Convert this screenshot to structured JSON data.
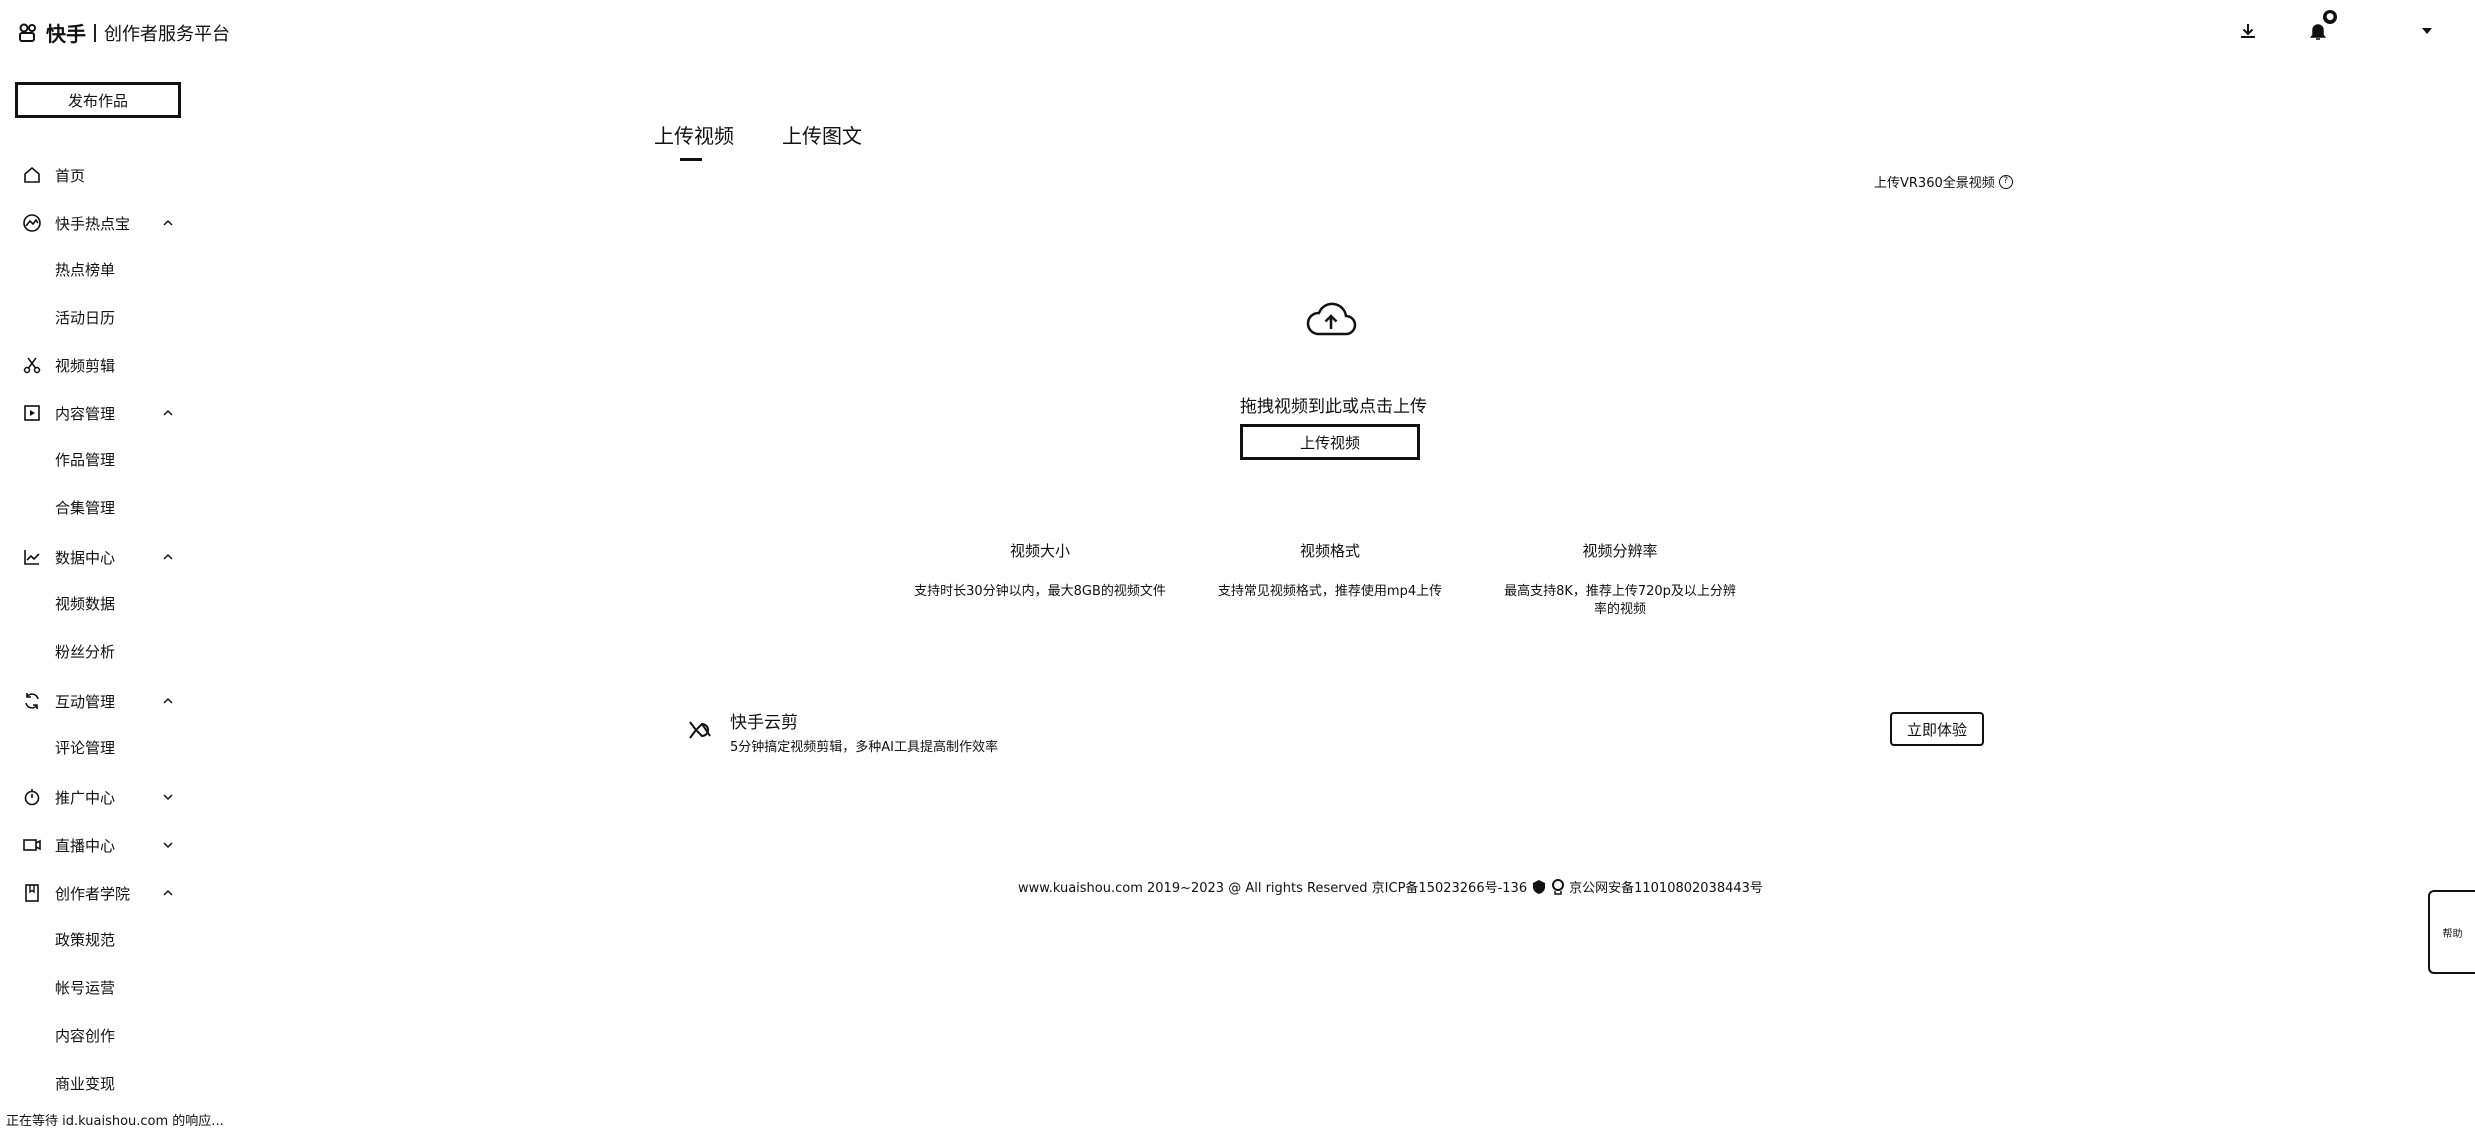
{
  "header": {
    "brand": "快手",
    "subtitle": "创作者服务平台"
  },
  "sidebar": {
    "publish_button": "发布作品",
    "items": [
      {
        "label": "首页",
        "icon": "home-icon",
        "expandable": false
      },
      {
        "label": "快手热点宝",
        "icon": "hotspot-icon",
        "expandable": true,
        "expanded": true
      },
      {
        "label": "热点榜单",
        "sub": true
      },
      {
        "label": "活动日历",
        "sub": true
      },
      {
        "label": "视频剪辑",
        "icon": "scissors-icon",
        "expandable": false
      },
      {
        "label": "内容管理",
        "icon": "play-square-icon",
        "expandable": true,
        "expanded": true
      },
      {
        "label": "作品管理",
        "sub": true
      },
      {
        "label": "合集管理",
        "sub": true
      },
      {
        "label": "数据中心",
        "icon": "chart-icon",
        "expandable": true,
        "expanded": true
      },
      {
        "label": "视频数据",
        "sub": true
      },
      {
        "label": "粉丝分析",
        "sub": true
      },
      {
        "label": "互动管理",
        "icon": "interaction-icon",
        "expandable": true,
        "expanded": true
      },
      {
        "label": "评论管理",
        "sub": true
      },
      {
        "label": "推广中心",
        "icon": "promotion-icon",
        "expandable": true,
        "expanded": false
      },
      {
        "label": "直播中心",
        "icon": "live-icon",
        "expandable": true,
        "expanded": false
      },
      {
        "label": "创作者学院",
        "icon": "book-icon",
        "expandable": true,
        "expanded": true
      },
      {
        "label": "政策规范",
        "sub": true
      },
      {
        "label": "帐号运营",
        "sub": true
      },
      {
        "label": "内容创作",
        "sub": true
      },
      {
        "label": "商业变现",
        "sub": true
      }
    ]
  },
  "main": {
    "tabs": [
      {
        "label": "上传视频",
        "active": true
      },
      {
        "label": "上传图文",
        "active": false
      }
    ],
    "vr_link": "上传VR360全景视频",
    "drag_text": "拖拽视频到此或点击上传",
    "upload_button": "上传视频",
    "specs": [
      {
        "title": "视频大小",
        "desc": "支持时长30分钟以内，最大8GB的视频文件"
      },
      {
        "title": "视频格式",
        "desc": "支持常见视频格式，推荐使用mp4上传"
      },
      {
        "title": "视频分辨率",
        "desc": "最高支持8K，推荐上传720p及以上分辨率的视频"
      }
    ],
    "yunjian": {
      "title": "快手云剪",
      "desc": "5分钟搞定视频剪辑，多种AI工具提高制作效率",
      "button": "立即体验"
    }
  },
  "footer": {
    "left": "www.kuaishou.com 2019~2023 @ All rights Reserved 京ICP备15023266号-136",
    "right": "京公网安备11010802038443号"
  },
  "float_panel": {
    "label": "帮助"
  },
  "status_bar": "正在等待 id.kuaishou.com 的响应..."
}
